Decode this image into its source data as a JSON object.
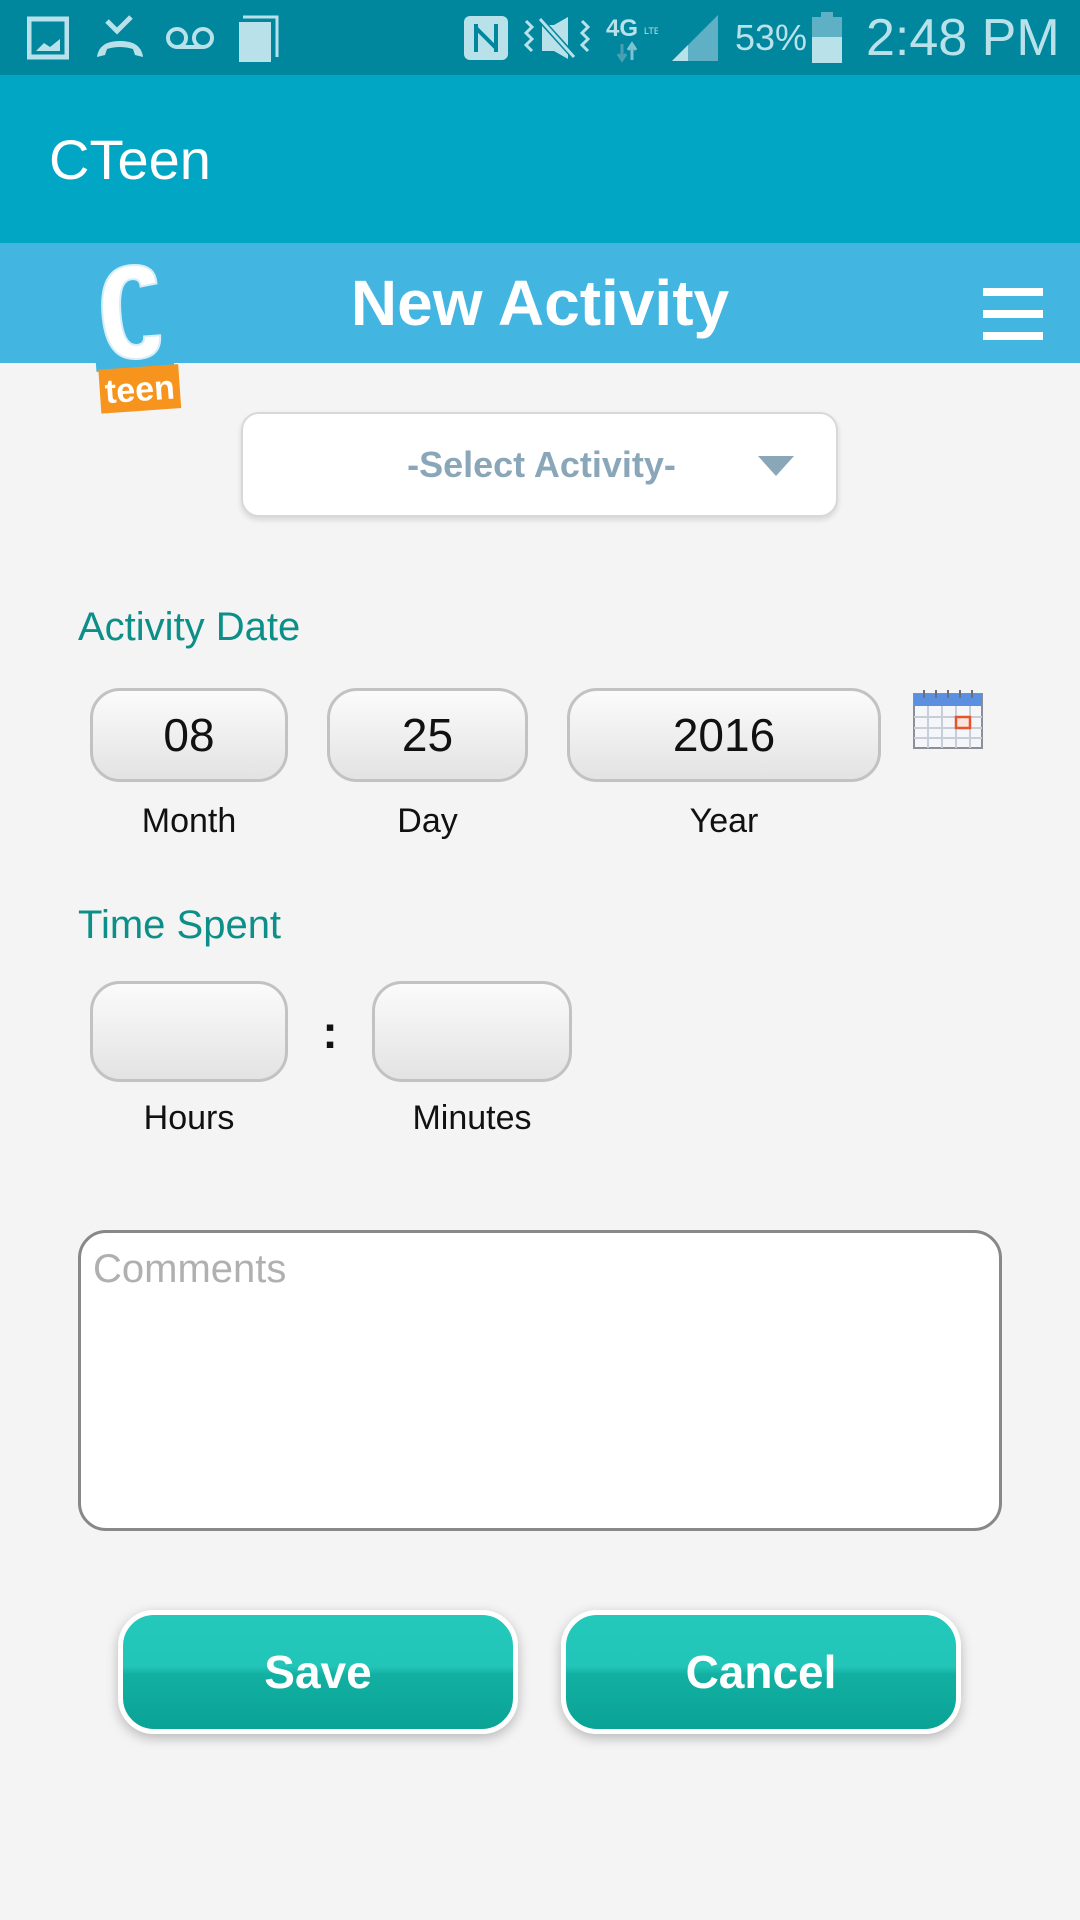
{
  "status_bar": {
    "left_icons": [
      "gallery-icon",
      "missed-call-icon",
      "voicemail-icon",
      "copy-icon"
    ],
    "right_icons": [
      "nfc-icon",
      "vibrate-mute-icon",
      "4g-lte-icon",
      "signal-icon",
      "battery-icon"
    ],
    "battery_percent": "53%",
    "battery_level": 0.53,
    "time": "2:48 PM"
  },
  "app_bar": {
    "title": "CTeen"
  },
  "header": {
    "title": "New Activity",
    "logo_letter": "C",
    "logo_text": "teen",
    "menu_icon": "hamburger-menu-icon"
  },
  "form": {
    "activity_select": {
      "selected": "-Select Activity-"
    },
    "activity_date": {
      "label": "Activity Date",
      "month": {
        "value": "08",
        "caption": "Month"
      },
      "day": {
        "value": "25",
        "caption": "Day"
      },
      "year": {
        "value": "2016",
        "caption": "Year"
      },
      "calendar_icon": "calendar-icon"
    },
    "time_spent": {
      "label": "Time Spent",
      "hours": {
        "value": "",
        "caption": "Hours"
      },
      "separator": ":",
      "minutes": {
        "value": "",
        "caption": "Minutes"
      }
    },
    "comments": {
      "value": "",
      "placeholder": "Comments"
    }
  },
  "buttons": {
    "save_label": "Save",
    "cancel_label": "Cancel"
  },
  "colors": {
    "status_bar": "#00869d",
    "app_bar": "#00a6c4",
    "header": "#42b5e0",
    "section_label": "#0c8f88",
    "button": "#1fbfb1",
    "logo_orange": "#f7941d"
  }
}
